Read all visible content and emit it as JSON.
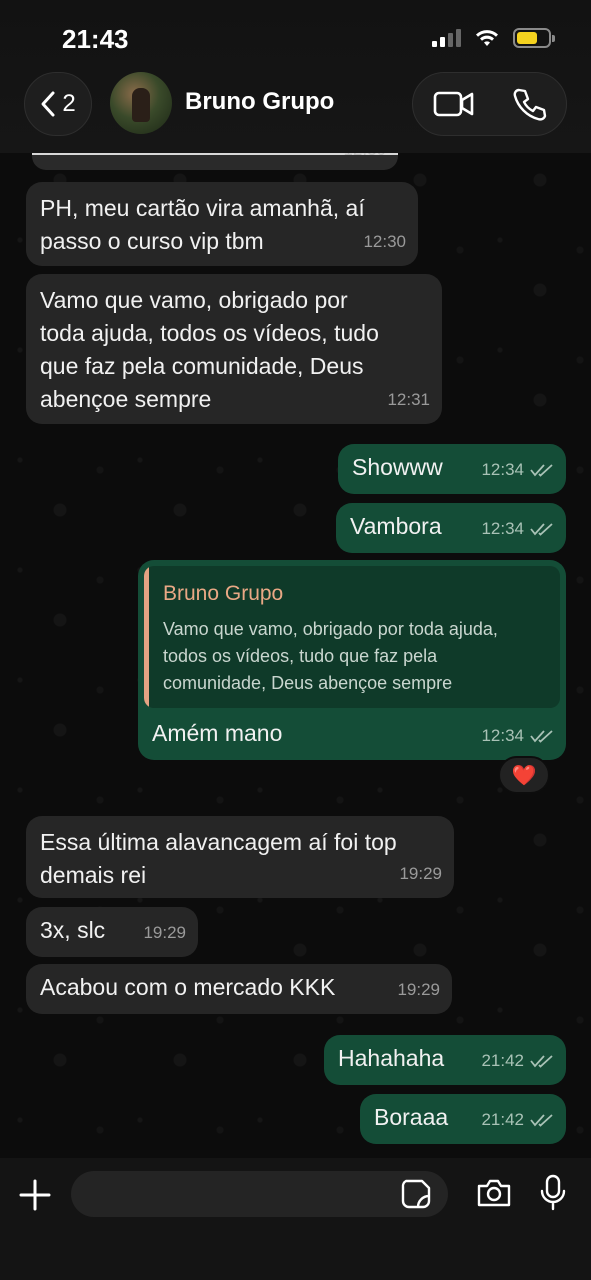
{
  "status_bar": {
    "time": "21:43"
  },
  "header": {
    "back_count": "2",
    "chat_title": "Bruno Grupo"
  },
  "partial_top": {
    "time": "12:30"
  },
  "messages": [
    {
      "text_lines": [
        "PH, meu cartão vira amanhã, aí",
        "passo o curso vip tbm"
      ],
      "time": "12:30"
    },
    {
      "text_lines": [
        "Vamo que vamo, obrigado por",
        "toda ajuda, todos os vídeos, tudo",
        "que faz pela comunidade, Deus",
        "abençoe sempre"
      ],
      "time": "12:31"
    },
    {
      "text": "Showww",
      "time": "12:34"
    },
    {
      "text": "Vambora",
      "time": "12:34"
    },
    {
      "quote_author": "Bruno Grupo",
      "quote_lines": [
        "Vamo que vamo, obrigado por toda ajuda,",
        "todos os vídeos, tudo que faz pela",
        "comunidade, Deus abençoe sempre"
      ],
      "text": "Amém mano",
      "time": "12:34",
      "reaction": "❤️"
    },
    {
      "text_lines": [
        "Essa última alavancagem aí foi top",
        "demais rei"
      ],
      "time": "19:29"
    },
    {
      "text": "3x, slc",
      "time": "19:29"
    },
    {
      "text": "Acabou com o mercado KKK",
      "time": "19:29"
    },
    {
      "text": "Hahahaha",
      "time": "21:42"
    },
    {
      "text": "Boraaa",
      "time": "21:42"
    }
  ],
  "composer": {
    "input_value": ""
  },
  "icons": {
    "back": "chevron-left-icon",
    "video": "video-camera-icon",
    "phone": "phone-icon",
    "plus": "plus-icon",
    "sticker": "sticker-icon",
    "camera": "camera-icon",
    "mic": "microphone-icon"
  },
  "colors": {
    "incoming_bubble": "#262626",
    "outgoing_bubble": "#144d37",
    "quote_accent": "#e5a383",
    "battery": "#f4d21f"
  }
}
